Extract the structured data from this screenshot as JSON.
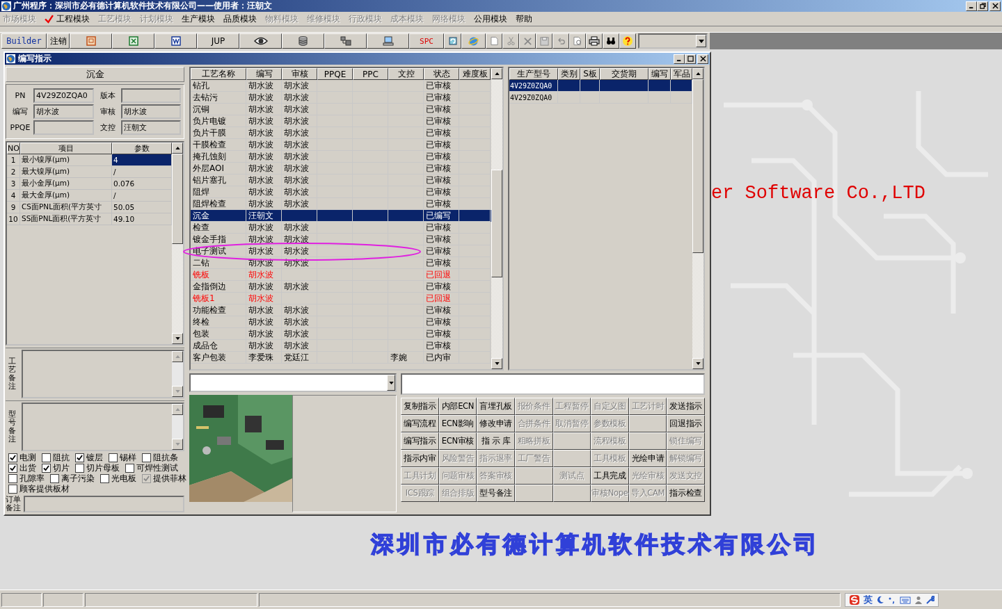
{
  "title_bar": {
    "title": "广州程序：深圳市必有德计算机软件技术有限公司——使用者：汪朝文"
  },
  "menu": [
    {
      "label": "市场模块",
      "disabled": true,
      "checked": false
    },
    {
      "label": "工程模块",
      "disabled": false,
      "checked": true
    },
    {
      "label": "工艺模块",
      "disabled": true,
      "checked": false
    },
    {
      "label": "计划模块",
      "disabled": true,
      "checked": false
    },
    {
      "label": "生产模块",
      "disabled": false,
      "checked": false
    },
    {
      "label": "品质模块",
      "disabled": false,
      "checked": false
    },
    {
      "label": "物料模块",
      "disabled": true,
      "checked": false
    },
    {
      "label": "维修模块",
      "disabled": true,
      "checked": false
    },
    {
      "label": "行政模块",
      "disabled": true,
      "checked": false
    },
    {
      "label": "成本模块",
      "disabled": true,
      "checked": false
    },
    {
      "label": "网络模块",
      "disabled": true,
      "checked": false
    },
    {
      "label": "公用模块",
      "disabled": false,
      "checked": false
    },
    {
      "label": "帮助",
      "disabled": false,
      "checked": false
    }
  ],
  "toolbar": {
    "labels": [
      "Builder",
      "注销",
      "JUP",
      "SPC"
    ]
  },
  "background": {
    "slogan": "er Software Co.,LTD",
    "company": "深圳市必有德计算机软件技术有限公司"
  },
  "child_window": {
    "title": "编写指示"
  },
  "left_panel": {
    "header": "沉金",
    "fields": [
      {
        "label": "PN",
        "value": "4V29Z0ZQA0"
      },
      {
        "label": "版本"
      },
      {
        "label": "编写",
        "value": "胡水波"
      },
      {
        "label": "审核",
        "value": "胡水波"
      },
      {
        "label": "PPQE"
      },
      {
        "label": "文控",
        "value": "汪朝文"
      }
    ],
    "param_columns": [
      "NO",
      "项目",
      "参数"
    ],
    "params": [
      {
        "no": "1",
        "item": "最小镍厚(μm)",
        "value": "4",
        "selected": true
      },
      {
        "no": "2",
        "item": "最大镍厚(μm)",
        "value": "/",
        "selected": false
      },
      {
        "no": "3",
        "item": "最小金厚(μm)",
        "value": "0.076",
        "selected": false
      },
      {
        "no": "4",
        "item": "最大金厚(μm)",
        "value": "/",
        "selected": false
      },
      {
        "no": "9",
        "item": "CS面PNL面积(平方英寸",
        "value": "50.05",
        "selected": false
      },
      {
        "no": "10",
        "item": "SS面PNL面积(平方英寸",
        "value": "49.10",
        "selected": false
      }
    ],
    "notes": [
      {
        "label": "工艺备注"
      },
      {
        "label": "型号备注"
      }
    ],
    "checks": [
      {
        "label": "电测",
        "checked": true,
        "disabled": false
      },
      {
        "label": "阻抗",
        "checked": false,
        "disabled": false
      },
      {
        "label": "镀层",
        "checked": true,
        "disabled": false
      },
      {
        "label": "锡样",
        "checked": false,
        "disabled": false
      },
      {
        "label": "阻抗条",
        "checked": false,
        "disabled": false
      },
      {
        "label": "出货",
        "checked": true,
        "disabled": false
      },
      {
        "label": "切片",
        "checked": true,
        "disabled": false
      },
      {
        "label": "切片母板",
        "checked": false,
        "disabled": false
      },
      {
        "label": "可焊性测试",
        "checked": false,
        "disabled": false
      },
      {
        "label": "孔隙率",
        "checked": false,
        "disabled": false
      },
      {
        "label": "离子污染",
        "checked": false,
        "disabled": false
      },
      {
        "label": "光电板",
        "checked": false,
        "disabled": false
      },
      {
        "label": "提供菲林",
        "checked": true,
        "disabled": true
      },
      {
        "label": "顾客提供板材",
        "checked": false,
        "disabled": false
      }
    ],
    "order_note": {
      "label": "订单备注"
    }
  },
  "process_table": {
    "columns": [
      "工艺名称",
      "编写",
      "审核",
      "PPQE",
      "PPC",
      "文控",
      "状态",
      "难度板"
    ],
    "rows": [
      {
        "name": "钻孔",
        "writer": "胡水波",
        "reviewer": "胡水波",
        "status": "已审核",
        "selected": false,
        "returned": false
      },
      {
        "name": "去钻污",
        "writer": "胡水波",
        "reviewer": "胡水波",
        "status": "已审核",
        "selected": false,
        "returned": false
      },
      {
        "name": "沉铜",
        "writer": "胡水波",
        "reviewer": "胡水波",
        "status": "已审核",
        "selected": false,
        "returned": false
      },
      {
        "name": "负片电镀",
        "writer": "胡水波",
        "reviewer": "胡水波",
        "status": "已审核",
        "selected": false,
        "returned": false
      },
      {
        "name": "负片干膜",
        "writer": "胡水波",
        "reviewer": "胡水波",
        "status": "已审核",
        "selected": false,
        "returned": false
      },
      {
        "name": "干膜检查",
        "writer": "胡水波",
        "reviewer": "胡水波",
        "status": "已审核",
        "selected": false,
        "returned": false
      },
      {
        "name": "掩孔蚀刻",
        "writer": "胡水波",
        "reviewer": "胡水波",
        "status": "已审核",
        "selected": false,
        "returned": false
      },
      {
        "name": "外层AOI",
        "writer": "胡水波",
        "reviewer": "胡水波",
        "status": "已审核",
        "selected": false,
        "returned": false
      },
      {
        "name": "铝片塞孔",
        "writer": "胡水波",
        "reviewer": "胡水波",
        "status": "已审核",
        "selected": false,
        "returned": false
      },
      {
        "name": "阻焊",
        "writer": "胡水波",
        "reviewer": "胡水波",
        "status": "已审核",
        "selected": false,
        "returned": false
      },
      {
        "name": "阻焊检查",
        "writer": "胡水波",
        "reviewer": "胡水波",
        "status": "已审核",
        "selected": false,
        "returned": false
      },
      {
        "name": "沉金",
        "writer": "汪朝文",
        "status": "已编写",
        "selected": true,
        "returned": false
      },
      {
        "name": "检查",
        "writer": "胡水波",
        "reviewer": "胡水波",
        "status": "已审核",
        "selected": false,
        "returned": false
      },
      {
        "name": "镀金手指",
        "writer": "胡水波",
        "reviewer": "胡水波",
        "status": "已审核",
        "selected": false,
        "returned": false
      },
      {
        "name": "电子测试",
        "writer": "胡水波",
        "reviewer": "胡水波",
        "status": "已审核",
        "selected": false,
        "returned": false
      },
      {
        "name": "二钻",
        "writer": "胡水波",
        "reviewer": "胡水波",
        "status": "已审核",
        "selected": false,
        "returned": false
      },
      {
        "name": "铣板",
        "writer": "胡水波",
        "status": "已回退",
        "selected": false,
        "returned": true
      },
      {
        "name": "金指倒边",
        "writer": "胡水波",
        "reviewer": "胡水波",
        "status": "已审核",
        "selected": false,
        "returned": false
      },
      {
        "name": "铣板1",
        "writer": "胡水波",
        "status": "已回退",
        "selected": false,
        "returned": true
      },
      {
        "name": "功能检查",
        "writer": "胡水波",
        "reviewer": "胡水波",
        "status": "已审核",
        "selected": false,
        "returned": false
      },
      {
        "name": "终检",
        "writer": "胡水波",
        "reviewer": "胡水波",
        "status": "已审核",
        "selected": false,
        "returned": false
      },
      {
        "name": "包装",
        "writer": "胡水波",
        "reviewer": "胡水波",
        "status": "已审核",
        "selected": false,
        "returned": false
      },
      {
        "name": "成品仓",
        "writer": "胡水波",
        "reviewer": "胡水波",
        "status": "已审核",
        "selected": false,
        "returned": false
      },
      {
        "name": "客户包装",
        "writer": "李爱珠",
        "reviewer": "党廷江",
        "doc_control": "李婉",
        "status": "已内审",
        "selected": false,
        "returned": false
      }
    ]
  },
  "model_table": {
    "columns": [
      "生产型号",
      "类别",
      "S板",
      "交货期",
      "编写",
      "军品"
    ],
    "rows": [
      {
        "model": "4V29Z0ZQA0",
        "selected": true
      },
      {
        "model": "4V29Z0ZQA0",
        "selected": false
      }
    ]
  },
  "action_buttons": [
    {
      "kind": "button",
      "label": "复制指示",
      "disabled": false
    },
    {
      "kind": "button",
      "label": "内部ECN",
      "disabled": false
    },
    {
      "kind": "button",
      "label": "盲埋孔板",
      "disabled": false
    },
    {
      "kind": "button",
      "label": "报价条件",
      "disabled": true
    },
    {
      "kind": "button",
      "label": "工程暂停",
      "disabled": true
    },
    {
      "kind": "button",
      "label": "自定义图",
      "disabled": true
    },
    {
      "kind": "button",
      "label": "工艺计时",
      "disabled": true
    },
    {
      "kind": "button",
      "label": "发送指示",
      "disabled": false
    },
    {
      "kind": "button",
      "label": "编写流程",
      "disabled": false
    },
    {
      "kind": "button",
      "label": "ECN影响",
      "disabled": false
    },
    {
      "kind": "button",
      "label": "修改申请",
      "disabled": false
    },
    {
      "kind": "button",
      "label": "合拼条件",
      "disabled": true
    },
    {
      "kind": "button",
      "label": "取消暂停",
      "disabled": true
    },
    {
      "kind": "button",
      "label": "参数模板",
      "disabled": true
    },
    {
      "kind": "blank"
    },
    {
      "kind": "button",
      "label": "回退指示",
      "disabled": false
    },
    {
      "kind": "button",
      "label": "编写指示",
      "disabled": false
    },
    {
      "kind": "button",
      "label": "ECN审核",
      "disabled": false
    },
    {
      "kind": "button",
      "label": "指 示 库",
      "disabled": false
    },
    {
      "kind": "button",
      "label": "粗略拼板",
      "disabled": true
    },
    {
      "kind": "blank"
    },
    {
      "kind": "button",
      "label": "流程模板",
      "disabled": true
    },
    {
      "kind": "blank"
    },
    {
      "kind": "button",
      "label": "锁住编写",
      "disabled": true
    },
    {
      "kind": "button",
      "label": "指示内审",
      "disabled": false
    },
    {
      "kind": "button",
      "label": "风险警告",
      "disabled": true
    },
    {
      "kind": "button",
      "label": "指示退率",
      "disabled": true
    },
    {
      "kind": "button",
      "label": "工厂警告",
      "disabled": true
    },
    {
      "kind": "blank"
    },
    {
      "kind": "button",
      "label": "工具模板",
      "disabled": true
    },
    {
      "kind": "button",
      "label": "光绘申请",
      "disabled": false
    },
    {
      "kind": "button",
      "label": "解锁编写",
      "disabled": true
    },
    {
      "kind": "button",
      "label": "工具计划",
      "disabled": true
    },
    {
      "kind": "button",
      "label": "问题审核",
      "disabled": true
    },
    {
      "kind": "button",
      "label": "答案审核",
      "disabled": true
    },
    {
      "kind": "blank"
    },
    {
      "kind": "button",
      "label": "测试点",
      "disabled": true
    },
    {
      "kind": "button",
      "label": "工具完成",
      "disabled": false
    },
    {
      "kind": "button",
      "label": "光绘审核",
      "disabled": true
    },
    {
      "kind": "button",
      "label": "发送文控",
      "disabled": true
    },
    {
      "kind": "button",
      "label": "ICS跟踪",
      "disabled": true
    },
    {
      "kind": "button",
      "label": "组合排版",
      "disabled": true
    },
    {
      "kind": "button",
      "label": "型号备注",
      "disabled": false
    },
    {
      "kind": "blank"
    },
    {
      "kind": "blank"
    },
    {
      "kind": "button",
      "label": "审核Nope",
      "disabled": true
    },
    {
      "kind": "button",
      "label": "导入CAM",
      "disabled": true
    },
    {
      "kind": "button",
      "label": "指示检查",
      "disabled": false
    }
  ],
  "status_bar": {
    "ime_label": "英"
  }
}
